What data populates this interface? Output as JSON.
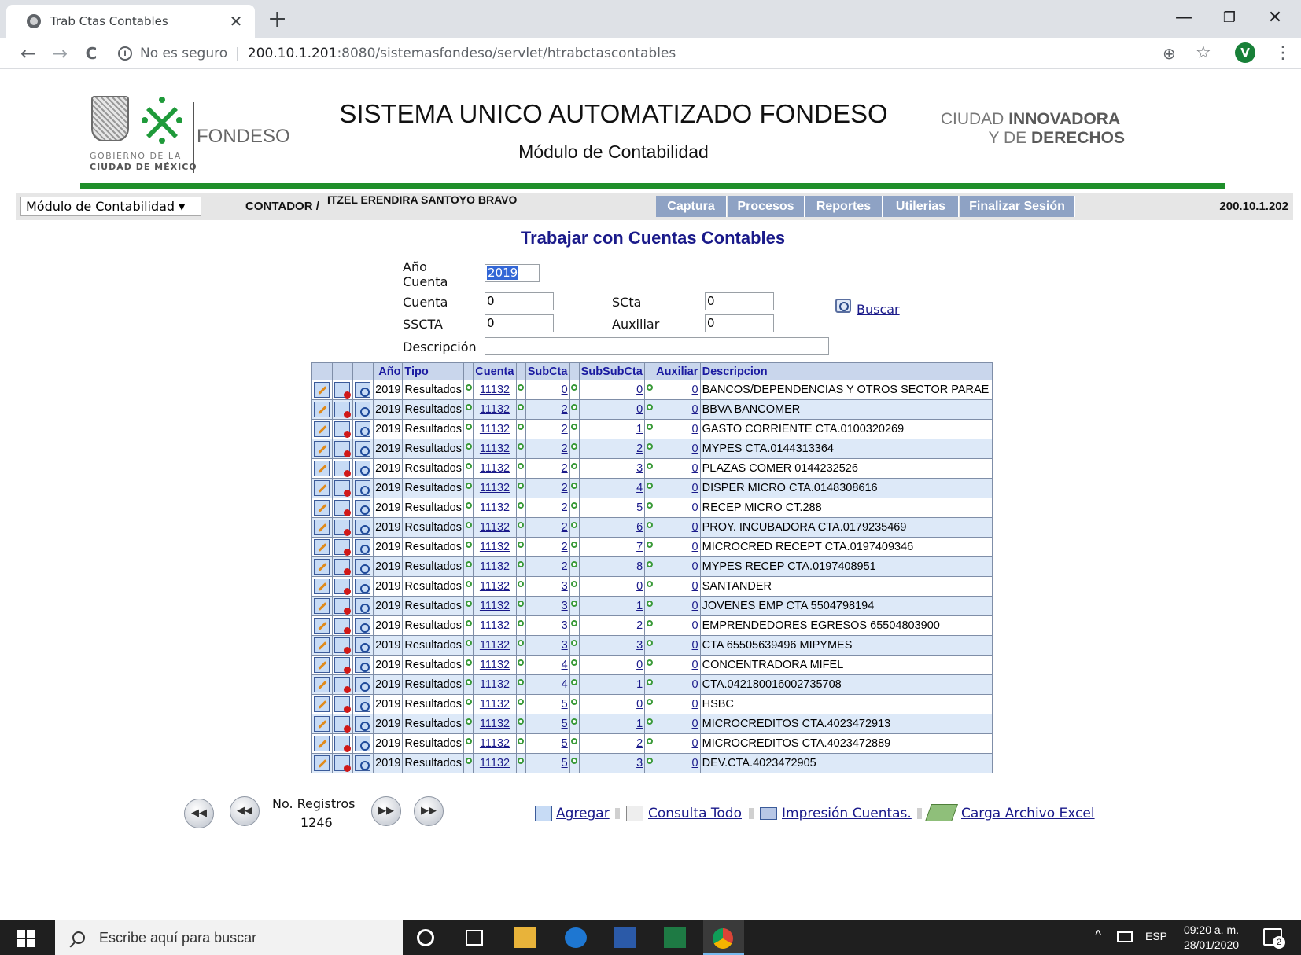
{
  "browser": {
    "tab_title": "Trab Ctas Contables",
    "close_glyph": "✕",
    "new_tab_glyph": "+",
    "minimize_glyph": "—",
    "restore_glyph": "❐",
    "window_close_glyph": "✕",
    "back_glyph": "←",
    "forward_glyph": "→",
    "reload_glyph": "C",
    "security_label": "No es seguro",
    "url_host": "200.10.1.201",
    "url_path": ":8080/sistemasfondeso/servlet/htrabctascontables",
    "zoom_glyph": "⊕",
    "star_glyph": "☆",
    "menu_glyph": "⋮",
    "profile_initial": "V"
  },
  "header": {
    "brand": "FONDESO",
    "gob_line1": "GOBIERNO DE LA",
    "gob_line2": "CIUDAD DE MÉXICO",
    "system_title": "SISTEMA UNICO AUTOMATIZADO FONDESO",
    "module_title": "Módulo de Contabilidad",
    "slogan_line1_a": "CIUDAD ",
    "slogan_line1_b": "INNOVADORA",
    "slogan_line2_a": "Y DE ",
    "slogan_line2_b": "DERECHOS",
    "accent_color": "#1f8f2a"
  },
  "menubar": {
    "module_select": "Módulo de Contabilidad ▾",
    "role": "CONTADOR /",
    "user": "ITZEL ERENDIRA SANTOYO BRAVO",
    "menu": [
      "Captura",
      "Procesos",
      "Reportes",
      "Utilerias",
      "Finalizar Sesión"
    ],
    "ip": "200.10.1.202"
  },
  "form": {
    "heading": "Trabajar con Cuentas Contables",
    "anio_label_1": "Año",
    "anio_label_2": "Cuenta",
    "anio_value": "2019",
    "cuenta_label": "Cuenta",
    "cuenta_value": "0",
    "scta_label": "SCta",
    "scta_value": "0",
    "sscta_label": "SSCTA",
    "sscta_value": "0",
    "auxiliar_label": "Auxiliar",
    "auxiliar_value": "0",
    "descripcion_label": "Descripción",
    "descripcion_value": "",
    "search_label": "Buscar"
  },
  "table": {
    "headers": [
      "Año",
      "Tipo",
      "Cuenta",
      "SubCta",
      "SubSubCta",
      "Auxiliar",
      "Descripcion"
    ],
    "rows": [
      {
        "anio": "2019",
        "tipo": "Resultados",
        "cuenta": "11132",
        "subcta": "0",
        "subsubcta": "0",
        "auxiliar": "0",
        "descripcion": "BANCOS/DEPENDENCIAS Y OTROS SECTOR PARAE"
      },
      {
        "anio": "2019",
        "tipo": "Resultados",
        "cuenta": "11132",
        "subcta": "2",
        "subsubcta": "0",
        "auxiliar": "0",
        "descripcion": "BBVA BANCOMER"
      },
      {
        "anio": "2019",
        "tipo": "Resultados",
        "cuenta": "11132",
        "subcta": "2",
        "subsubcta": "1",
        "auxiliar": "0",
        "descripcion": "GASTO CORRIENTE CTA.0100320269"
      },
      {
        "anio": "2019",
        "tipo": "Resultados",
        "cuenta": "11132",
        "subcta": "2",
        "subsubcta": "2",
        "auxiliar": "0",
        "descripcion": "MYPES CTA.0144313364"
      },
      {
        "anio": "2019",
        "tipo": "Resultados",
        "cuenta": "11132",
        "subcta": "2",
        "subsubcta": "3",
        "auxiliar": "0",
        "descripcion": "PLAZAS COMER 0144232526"
      },
      {
        "anio": "2019",
        "tipo": "Resultados",
        "cuenta": "11132",
        "subcta": "2",
        "subsubcta": "4",
        "auxiliar": "0",
        "descripcion": "DISPER MICRO CTA.0148308616"
      },
      {
        "anio": "2019",
        "tipo": "Resultados",
        "cuenta": "11132",
        "subcta": "2",
        "subsubcta": "5",
        "auxiliar": "0",
        "descripcion": "RECEP MICRO CT.288"
      },
      {
        "anio": "2019",
        "tipo": "Resultados",
        "cuenta": "11132",
        "subcta": "2",
        "subsubcta": "6",
        "auxiliar": "0",
        "descripcion": "PROY. INCUBADORA CTA.0179235469"
      },
      {
        "anio": "2019",
        "tipo": "Resultados",
        "cuenta": "11132",
        "subcta": "2",
        "subsubcta": "7",
        "auxiliar": "0",
        "descripcion": "MICROCRED RECEPT CTA.0197409346"
      },
      {
        "anio": "2019",
        "tipo": "Resultados",
        "cuenta": "11132",
        "subcta": "2",
        "subsubcta": "8",
        "auxiliar": "0",
        "descripcion": "MYPES RECEP CTA.0197408951"
      },
      {
        "anio": "2019",
        "tipo": "Resultados",
        "cuenta": "11132",
        "subcta": "3",
        "subsubcta": "0",
        "auxiliar": "0",
        "descripcion": "SANTANDER"
      },
      {
        "anio": "2019",
        "tipo": "Resultados",
        "cuenta": "11132",
        "subcta": "3",
        "subsubcta": "1",
        "auxiliar": "0",
        "descripcion": "JOVENES EMP CTA 5504798194"
      },
      {
        "anio": "2019",
        "tipo": "Resultados",
        "cuenta": "11132",
        "subcta": "3",
        "subsubcta": "2",
        "auxiliar": "0",
        "descripcion": "EMPRENDEDORES EGRESOS 65504803900"
      },
      {
        "anio": "2019",
        "tipo": "Resultados",
        "cuenta": "11132",
        "subcta": "3",
        "subsubcta": "3",
        "auxiliar": "0",
        "descripcion": "CTA 65505639496 MIPYMES"
      },
      {
        "anio": "2019",
        "tipo": "Resultados",
        "cuenta": "11132",
        "subcta": "4",
        "subsubcta": "0",
        "auxiliar": "0",
        "descripcion": "CONCENTRADORA MIFEL"
      },
      {
        "anio": "2019",
        "tipo": "Resultados",
        "cuenta": "11132",
        "subcta": "4",
        "subsubcta": "1",
        "auxiliar": "0",
        "descripcion": "CTA.042180016002735708"
      },
      {
        "anio": "2019",
        "tipo": "Resultados",
        "cuenta": "11132",
        "subcta": "5",
        "subsubcta": "0",
        "auxiliar": "0",
        "descripcion": "HSBC"
      },
      {
        "anio": "2019",
        "tipo": "Resultados",
        "cuenta": "11132",
        "subcta": "5",
        "subsubcta": "1",
        "auxiliar": "0",
        "descripcion": "MICROCREDITOS CTA.4023472913"
      },
      {
        "anio": "2019",
        "tipo": "Resultados",
        "cuenta": "11132",
        "subcta": "5",
        "subsubcta": "2",
        "auxiliar": "0",
        "descripcion": "MICROCREDITOS CTA.4023472889"
      },
      {
        "anio": "2019",
        "tipo": "Resultados",
        "cuenta": "11132",
        "subcta": "5",
        "subsubcta": "3",
        "auxiliar": "0",
        "descripcion": "DEV.CTA.4023472905"
      }
    ]
  },
  "pager": {
    "first_glyph": "◀◀",
    "prev_glyph": "◀◀",
    "next_glyph": "▶▶",
    "last_glyph": "▶▶",
    "label": "No. Registros",
    "count": "1246"
  },
  "actions": [
    "Agregar",
    "Consulta Todo",
    "Impresión Cuentas.",
    "Carga Archivo Excel"
  ],
  "taskbar": {
    "search_placeholder": "Escribe aquí para buscar",
    "language": "ESP",
    "time": "09:20 a. m.",
    "date": "28/01/2020",
    "tray_up_glyph": "^",
    "notification_count": "2"
  }
}
